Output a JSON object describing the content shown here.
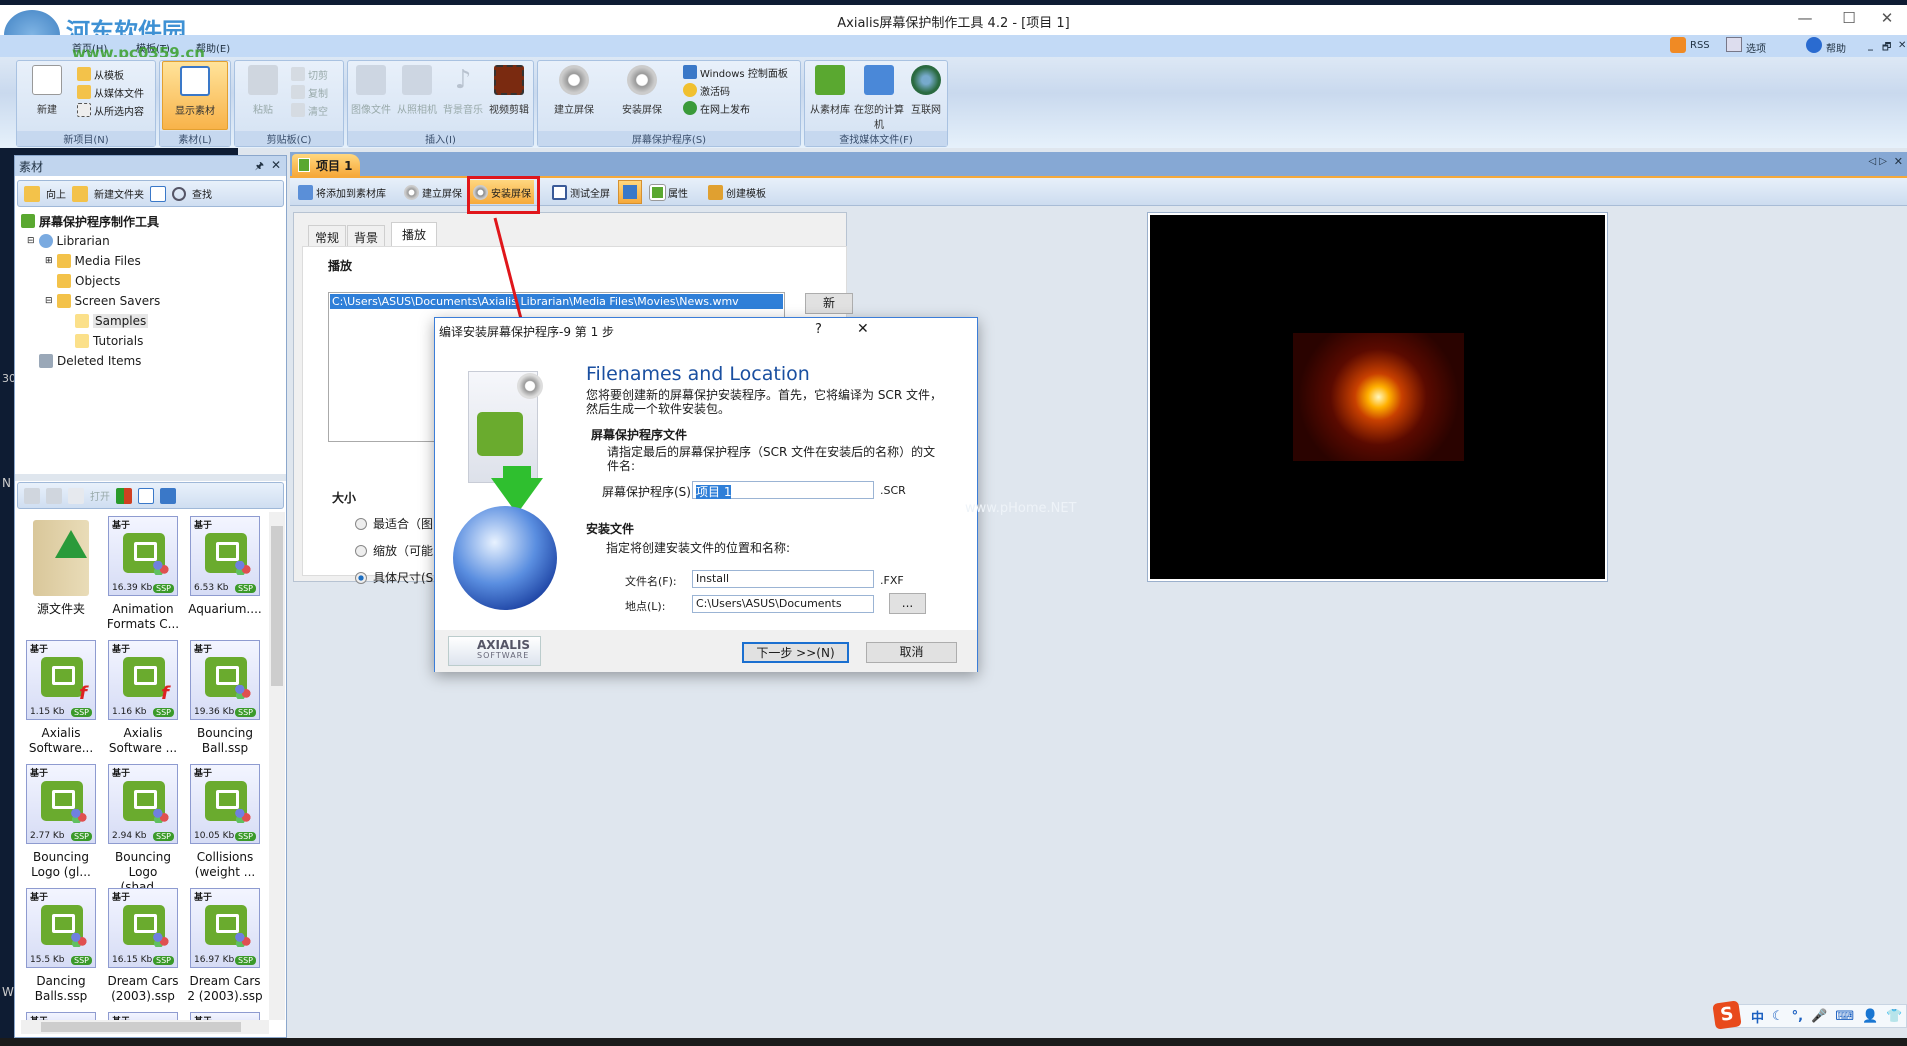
{
  "window": {
    "title": "Axialis屏幕保护制作工具 4.2 - [项目 1]",
    "minimize": "—",
    "maximize": "☐",
    "close": "✕"
  },
  "watermark": {
    "logo_text": "河东软件园",
    "url": "www.pc0359.cn",
    "dialog_mark": "www.pHome.NET"
  },
  "ribbon": {
    "tabs": [
      "首页(H)",
      "模板(T)",
      "帮助(E)"
    ],
    "right_menu": {
      "rss": "RSS",
      "options": "选项",
      "help": "帮助",
      "mdi_min": "_",
      "mdi_restore": "🗗",
      "mdi_close": "✕"
    },
    "groups": {
      "new": {
        "label": "新项目(N)",
        "big": "新建",
        "items": [
          "从模板",
          "从媒体文件",
          "从所选内容"
        ]
      },
      "material": {
        "label": "素材(L)",
        "big": "显示素材"
      },
      "clipboard": {
        "label": "剪贴板(C)",
        "big": "粘贴",
        "items": [
          "切剪",
          "复制",
          "清空"
        ]
      },
      "insert": {
        "label": "插入(I)",
        "items": [
          "图像文件",
          "从照相机",
          "背景音乐",
          "视频剪辑"
        ]
      },
      "screensaver": {
        "label": "屏幕保护程序(S)",
        "big": [
          "建立屏保",
          "安装屏保"
        ],
        "items": [
          "Windows 控制面板",
          "激活码",
          "在网上发布"
        ]
      },
      "find": {
        "label": "查找媒体文件(F)",
        "items": [
          "从素材库",
          "在您的计算机",
          "互联网"
        ]
      }
    }
  },
  "desktop_fragments": [
    "30",
    "N",
    "W"
  ],
  "left_panel": {
    "title": "素材",
    "pin": "🖈",
    "close": "✕",
    "toolbar": {
      "up": "向上",
      "new_folder": "新建文件夹",
      "find": "查找"
    },
    "tree": [
      {
        "label": "屏幕保护程序制作工具"
      },
      {
        "label": "Librarian"
      },
      {
        "label": "Media Files"
      },
      {
        "label": "Objects"
      },
      {
        "label": "Screen Savers"
      },
      {
        "label": "Samples"
      },
      {
        "label": "Tutorials"
      },
      {
        "label": "Deleted Items"
      }
    ],
    "toolbar2": {
      "open": "打开"
    },
    "thumbnails": {
      "based_label": "基于",
      "badge": "SSP",
      "items": [
        {
          "name": "源文件夹",
          "kind": "folder"
        },
        {
          "name": "Animation Formats C...",
          "size": "16.39 Kb",
          "kind": "orb"
        },
        {
          "name": "Aquarium....",
          "size": "6.53 Kb",
          "kind": "orb"
        },
        {
          "name": "Axialis Software...",
          "size": "1.15 Kb",
          "kind": "flash"
        },
        {
          "name": "Axialis Software ...",
          "size": "1.16 Kb",
          "kind": "flash"
        },
        {
          "name": "Bouncing Ball.ssp",
          "size": "19.36 Kb",
          "kind": "orb"
        },
        {
          "name": "Bouncing Logo (gl...",
          "size": "2.77 Kb",
          "kind": "orb"
        },
        {
          "name": "Bouncing Logo (shad...",
          "size": "2.94 Kb",
          "kind": "orb"
        },
        {
          "name": "Collisions (weight ...",
          "size": "10.05 Kb",
          "kind": "orb"
        },
        {
          "name": "Dancing Balls.ssp",
          "size": "15.5 Kb",
          "kind": "orb"
        },
        {
          "name": "Dream Cars (2003).ssp",
          "size": "16.15 Kb",
          "kind": "orb"
        },
        {
          "name": "Dream Cars 2 (2003).ssp",
          "size": "16.97 Kb",
          "kind": "orb"
        },
        {
          "name": "",
          "kind": "partial"
        },
        {
          "name": "",
          "kind": "partial"
        },
        {
          "name": "",
          "kind": "partial"
        }
      ]
    }
  },
  "document": {
    "tab": "项目 1",
    "toolbar": [
      "将添加到素材库",
      "建立屏保",
      "安装屏保",
      "测试全屏",
      "属性",
      "创建模板"
    ],
    "props": {
      "tabs": [
        "常规",
        "背景",
        "播放"
      ],
      "section": "播放",
      "playlist": [
        "C:\\Users\\ASUS\\Documents\\Axialis Librarian\\Media Files\\Movies\\News.wmv"
      ],
      "new_button": "新",
      "size_label": "大小",
      "size_options": [
        {
          "label": "最适合（图",
          "selected": false
        },
        {
          "label": "缩放（可能",
          "selected": false
        },
        {
          "label": "具体尺寸(S):",
          "selected": true
        }
      ]
    }
  },
  "dialog": {
    "title": "编译安装屏幕保护程序-9 第 1 步",
    "help": "?",
    "close": "✕",
    "heading": "Filenames and Location",
    "intro": "您将要创建新的屏幕保护安装程序。首先，它将编译为 SCR 文件，然后生成一个软件安装包。",
    "section1": "屏幕保护程序文件",
    "section1_desc": "请指定最后的屏幕保护程序（SCR 文件在安装后的名称）的文件名:",
    "scr_label": "屏幕保护程序(S)",
    "scr_value": "项目 1",
    "scr_ext": ".SCR",
    "section2": "安装文件",
    "section2_desc": "指定将创建安装文件的位置和名称:",
    "file_label": "文件名(F):",
    "file_value": "Install",
    "file_ext": ".FXF",
    "location_label": "地点(L):",
    "location_value": "C:\\Users\\ASUS\\Documents",
    "browse": "...",
    "logo_top": "AXIALIS",
    "logo_bottom": "SOFTWARE",
    "next": "下一步 >>(N)",
    "cancel": "取消"
  },
  "tray": {
    "ime": "S",
    "items": [
      "中",
      "☾",
      "°,",
      "🎤",
      "⌨",
      "👤",
      "👕"
    ]
  },
  "colors": {
    "accent_blue": "#1a4fa0",
    "highlight_red": "#e0161b",
    "ribbon_bg": "#c9d9ee",
    "active_orange": "#f6a93a"
  }
}
